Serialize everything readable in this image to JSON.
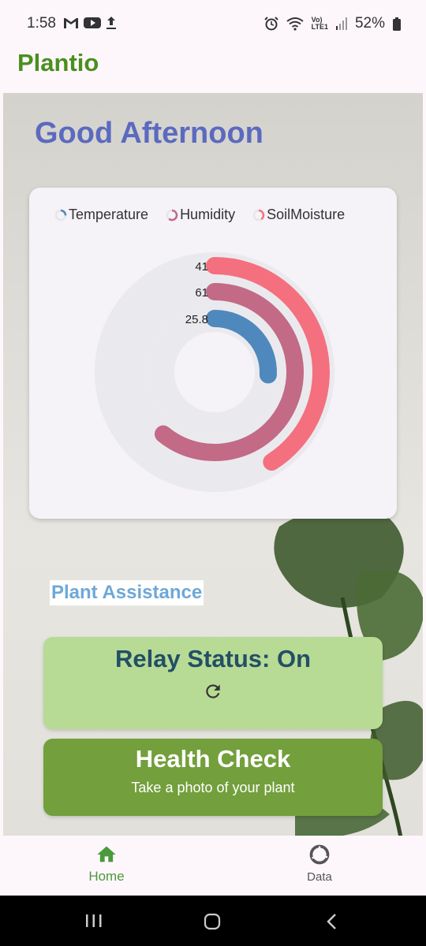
{
  "status_bar": {
    "time": "1:58",
    "left_icons": [
      "gmail-icon",
      "youtube-icon",
      "upload-icon"
    ],
    "right_icons": [
      "alarm-icon",
      "wifi-icon",
      "volte-lte-icon",
      "signal-icon",
      "battery-icon"
    ],
    "volte_label": "Vo)",
    "lte_label": "LTE1",
    "battery": "52%"
  },
  "app": {
    "title": "Plantio"
  },
  "main": {
    "greeting": "Good Afternoon",
    "plant_assistance_label": "Plant Assistance"
  },
  "chart_data": {
    "type": "radialBar",
    "legend_position": "top",
    "series": [
      {
        "name": "Temperature",
        "value": 25.8,
        "color": "#4f88bc"
      },
      {
        "name": "Humidity",
        "value": 61,
        "color": "#c26a86"
      },
      {
        "name": "SoilMoisture",
        "value": 41,
        "color": "#f4707f"
      }
    ],
    "track_color": "#eaeaee"
  },
  "relay": {
    "label": "Relay Status: On",
    "refresh_icon": "refresh-icon"
  },
  "health": {
    "title": "Health Check",
    "subtitle": "Take a photo of your plant"
  },
  "bottom_nav": {
    "items": [
      {
        "label": "Home",
        "icon": "home-icon",
        "active": true,
        "color": "#4a9a3a"
      },
      {
        "label": "Data",
        "icon": "donut-chart-icon",
        "active": false,
        "color": "#555555"
      }
    ]
  },
  "system_nav": [
    "recents-button",
    "home-button",
    "back-button"
  ]
}
